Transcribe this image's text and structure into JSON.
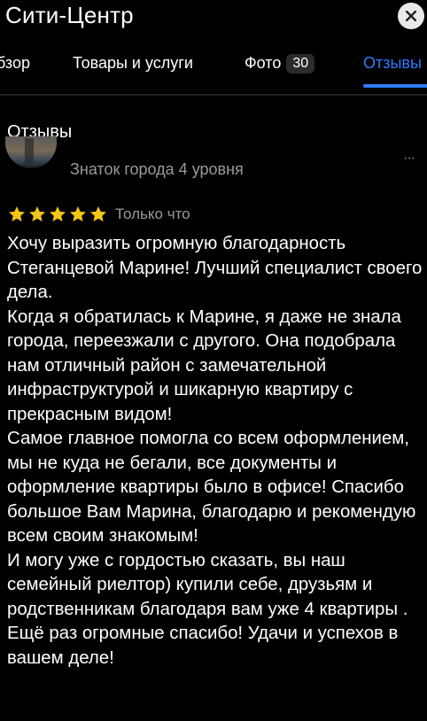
{
  "header": {
    "title": "Сити-Центр",
    "close_icon": "close-icon"
  },
  "tabs": [
    {
      "label": "бзор",
      "active": false
    },
    {
      "label": "Товары и услуги",
      "active": false
    },
    {
      "label": "Фото",
      "badge": "30",
      "active": false
    },
    {
      "label": "Отзывы",
      "active": true
    }
  ],
  "colors": {
    "accent": "#2f7bff",
    "star": "#f5c518",
    "muted_text": "#9a9a9a",
    "background": "#000000"
  },
  "reviews": {
    "section_title": "Отзывы",
    "review": {
      "author_level": "Знаток города 4 уровня",
      "more_icon": "more-dots-icon",
      "more_glyph": "···",
      "rating": 5,
      "time": "Только что",
      "paragraphs": [
        "Хочу выразить огромную благодарность Стеганцевой Марине!  Лучший специалист своего дела.",
        "Когда я обратилась к Марине, я даже не знала города, переезжали с другого. Она подобрала нам отличный район с замечательной инфраструктурой и шикарную квартиру с прекрасным видом!",
        "Самое главное помогла со всем оформлением, мы не куда не бегали, все документы и оформление квартиры было в офисе! Спасибо большое Вам Марина, благодарю и рекомендую всем своим знакомым!",
        "И могу уже с гордостью сказать, вы наш семейный риелтор) купили себе, друзьям и родственникам благодаря вам уже 4 квартиры .",
        "Ещё раз огромные спасибо! Удачи и успехов в вашем деле!"
      ]
    }
  }
}
